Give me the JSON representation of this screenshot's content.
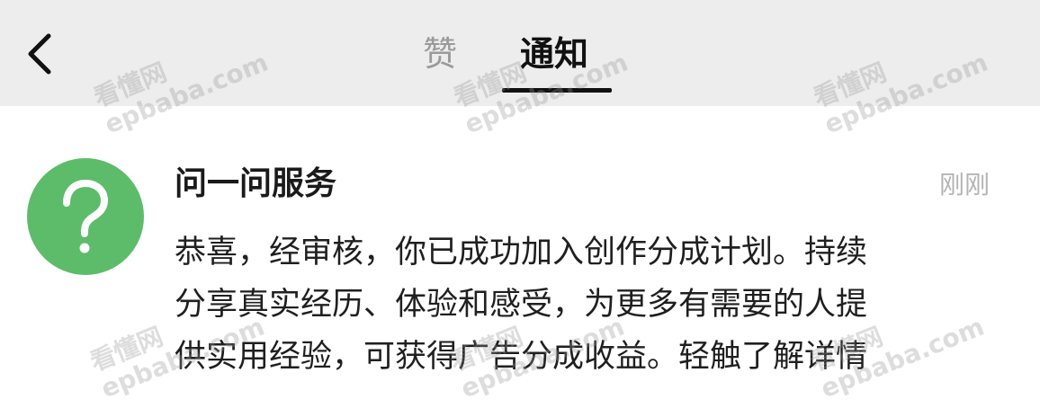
{
  "header": {
    "tabs": [
      {
        "label": "赞",
        "active": false
      },
      {
        "label": "通知",
        "active": true
      }
    ],
    "back_icon": "chevron-left-icon"
  },
  "notification": {
    "sender": "问一问服务",
    "time": "刚刚",
    "avatar_icon": "question-mark-icon",
    "avatar_color": "#5dbc6a",
    "message_lines": [
      "恭喜，经审核，你已成功加入创作分成计划。持续",
      "分享真实经历、体验和感受，为更多有需要的人提",
      "供实用经验，可获得广告分成收益。轻触了解详情"
    ]
  },
  "watermark": {
    "cn": "看懂网",
    "en": "epbaba.com"
  }
}
